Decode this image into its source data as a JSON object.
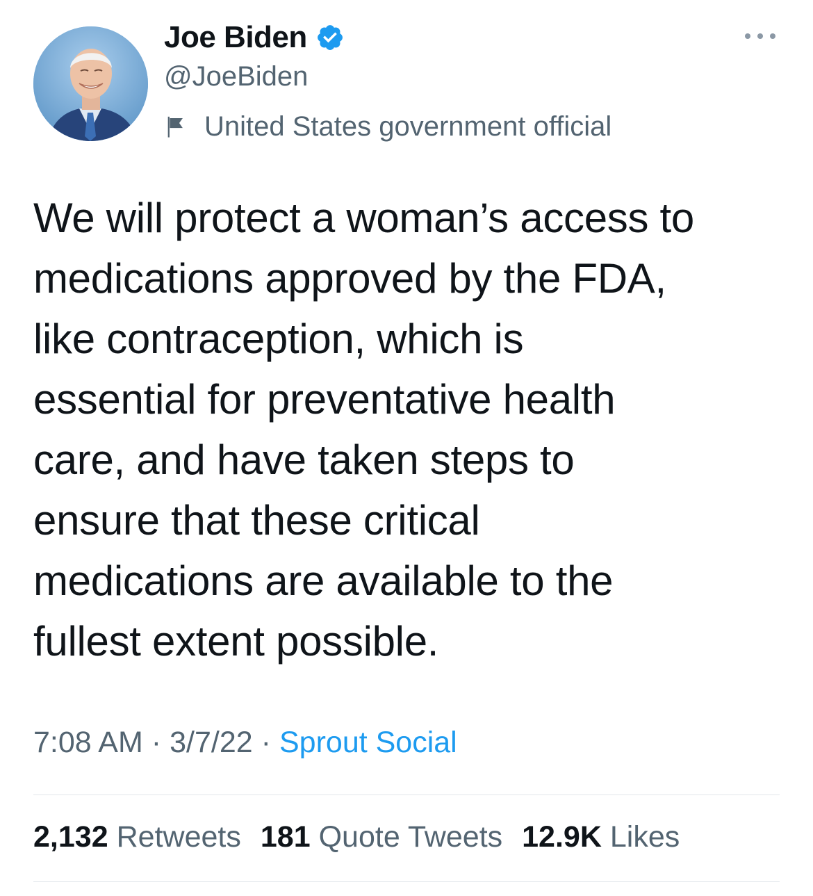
{
  "author": {
    "display_name": "Joe Biden",
    "handle": "@JoeBiden",
    "label": "United States government official",
    "verified_color": "#1d9bf0"
  },
  "tweet": {
    "text": "We will protect a woman’s access to\nmedications approved by the FDA,\nlike contraception, which is\nessential for preventative health\ncare, and have taken steps to\nensure that these critical\nmedications are available to the\nfullest extent possible."
  },
  "meta": {
    "time": "7:08 AM",
    "separator": "·",
    "date": "3/7/22",
    "source": "Sprout Social"
  },
  "stats": {
    "retweets_count": "2,132",
    "retweets_label": "Retweets",
    "quotes_count": "181",
    "quotes_label": "Quote Tweets",
    "likes_count": "12.9K",
    "likes_label": "Likes"
  },
  "colors": {
    "text_primary": "#0f1419",
    "text_secondary": "#536471",
    "link": "#1d9bf0"
  },
  "icons": {
    "verified": "verified-badge-icon",
    "flag": "government-flag-icon",
    "more": "more-options-icon"
  }
}
